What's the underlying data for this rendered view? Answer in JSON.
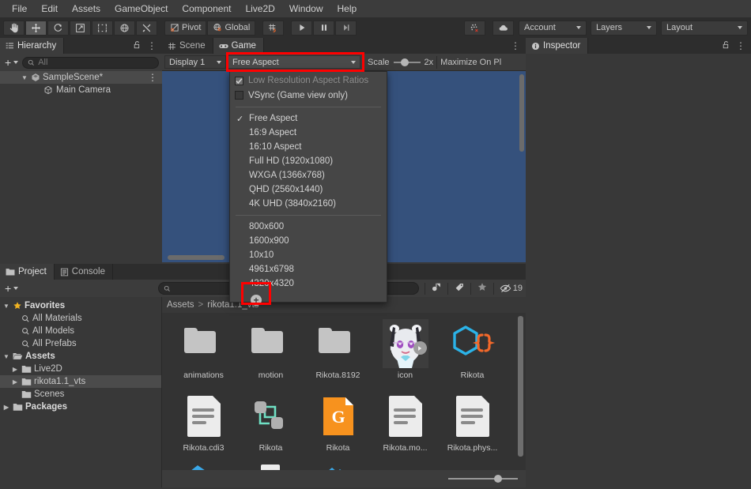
{
  "menubar": {
    "items": [
      "File",
      "Edit",
      "Assets",
      "GameObject",
      "Component",
      "Live2D",
      "Window",
      "Help"
    ]
  },
  "toolbar": {
    "tools": [
      {
        "name": "hand-tool",
        "icon": "hand-icon",
        "active": false
      },
      {
        "name": "move-tool",
        "icon": "move-icon",
        "active": true
      },
      {
        "name": "rotate-tool",
        "icon": "rotate-icon",
        "active": false
      },
      {
        "name": "scale-tool",
        "icon": "scale-icon",
        "active": false
      },
      {
        "name": "rect-tool",
        "icon": "rect-transform-icon",
        "active": false
      },
      {
        "name": "transform-tool",
        "icon": "transform-icon",
        "active": false
      },
      {
        "name": "custom-editor-tool",
        "icon": "tools-icon",
        "active": false
      }
    ],
    "pivot_label": "Pivot",
    "global_label": "Global",
    "snap_label": "grid-snap-icon",
    "play_label": "play-icon",
    "pause_label": "pause-icon",
    "step_label": "step-icon",
    "collab_label": "collab-icon",
    "cloud_label": "cloud-icon",
    "account_label": "Account",
    "layers_label": "Layers",
    "layout_label": "Layout"
  },
  "hierarchy": {
    "tab_label": "Hierarchy",
    "search_placeholder": "All",
    "add_label": "+",
    "rows": [
      {
        "label": "SampleScene*",
        "icon": "scene-icon",
        "depth": 1,
        "selected": true,
        "expanded": true
      },
      {
        "label": "Main Camera",
        "icon": "gameobject-icon",
        "depth": 2,
        "selected": false,
        "expanded": false
      }
    ]
  },
  "gamepanel": {
    "tabs": [
      {
        "label": "Scene",
        "icon": "scene-grid-icon",
        "active": false
      },
      {
        "label": "Game",
        "icon": "gamepad-icon",
        "active": true
      }
    ],
    "display_label": "Display 1",
    "aspect_label": "Free Aspect",
    "scale_label": "Scale",
    "scale_value": "2x",
    "maximize_label": "Maximize On Pl",
    "background_color": "#35517c"
  },
  "aspect_menu": {
    "options_top": [
      {
        "label": "Low Resolution Aspect Ratios",
        "type": "checkbox",
        "checked": true,
        "disabled": true
      },
      {
        "label": "VSync (Game view only)",
        "type": "checkbox",
        "checked": false,
        "disabled": false
      }
    ],
    "options_aspect": [
      {
        "label": "Free Aspect",
        "checked": true
      },
      {
        "label": "16:9 Aspect",
        "checked": false
      },
      {
        "label": "16:10 Aspect",
        "checked": false
      },
      {
        "label": "Full HD (1920x1080)",
        "checked": false
      },
      {
        "label": "WXGA (1366x768)",
        "checked": false
      },
      {
        "label": "QHD (2560x1440)",
        "checked": false
      },
      {
        "label": "4K UHD (3840x2160)",
        "checked": false
      }
    ],
    "options_custom": [
      {
        "label": "800x600"
      },
      {
        "label": "1600x900"
      },
      {
        "label": "10x10"
      },
      {
        "label": "4961x6798"
      },
      {
        "label": "4320x4320"
      }
    ],
    "add_label": "+"
  },
  "inspector": {
    "tab_label": "Inspector"
  },
  "project": {
    "tabs": [
      {
        "label": "Project",
        "icon": "folder-icon",
        "active": true
      },
      {
        "label": "Console",
        "icon": "console-icon",
        "active": false
      }
    ],
    "search_placeholder": "",
    "hidden_count": "19",
    "breadcrumb": [
      "Assets",
      "rikota1.1_vts"
    ],
    "tree": [
      {
        "label": "Favorites",
        "icon": "star-icon",
        "depth": 0,
        "expanded": true,
        "bold": true,
        "selected": false
      },
      {
        "label": "All Materials",
        "icon": "search-icon",
        "depth": 1,
        "expanded": false,
        "bold": false,
        "selected": false
      },
      {
        "label": "All Models",
        "icon": "search-icon",
        "depth": 1,
        "expanded": false,
        "bold": false,
        "selected": false
      },
      {
        "label": "All Prefabs",
        "icon": "search-icon",
        "depth": 1,
        "expanded": false,
        "bold": false,
        "selected": false
      },
      {
        "label": "Assets",
        "icon": "open-folder-icon",
        "depth": 0,
        "expanded": true,
        "bold": true,
        "selected": false
      },
      {
        "label": "Live2D",
        "icon": "folder-icon",
        "depth": 1,
        "expanded": false,
        "bold": false,
        "selected": false,
        "collapsible": true
      },
      {
        "label": "rikota1.1_vts",
        "icon": "folder-icon",
        "depth": 1,
        "expanded": false,
        "bold": false,
        "selected": true,
        "collapsible": true
      },
      {
        "label": "Scenes",
        "icon": "folder-icon",
        "depth": 1,
        "expanded": false,
        "bold": false,
        "selected": false
      },
      {
        "label": "Packages",
        "icon": "folder-icon",
        "depth": 0,
        "expanded": false,
        "bold": true,
        "selected": false,
        "collapsible": true
      }
    ],
    "assets": [
      [
        {
          "label": "animations",
          "kind": "folder"
        },
        {
          "label": "motion",
          "kind": "folder"
        },
        {
          "label": "Rikota.8192",
          "kind": "folder"
        },
        {
          "label": "icon",
          "kind": "image"
        },
        {
          "label": "Rikota",
          "kind": "prefab-json"
        }
      ],
      [
        {
          "label": "Rikota.cdi3",
          "kind": "document"
        },
        {
          "label": "Rikota",
          "kind": "prefab"
        },
        {
          "label": "Rikota",
          "kind": "moc"
        },
        {
          "label": "Rikota.mo...",
          "kind": "document"
        },
        {
          "label": "Rikota.phys...",
          "kind": "document"
        }
      ],
      [
        {
          "label": "",
          "kind": "partial-blue"
        },
        {
          "label": "",
          "kind": "partial-white"
        },
        {
          "label": "",
          "kind": "partial-blue2"
        }
      ]
    ]
  }
}
